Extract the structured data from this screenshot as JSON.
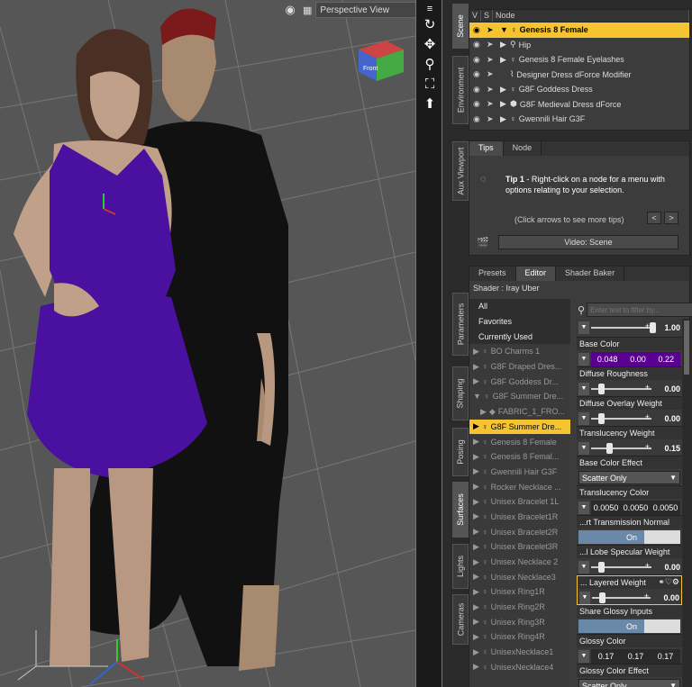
{
  "viewport": {
    "view_label": "Perspective View",
    "cube_label": "Front"
  },
  "side_tabs": [
    "Scene",
    "Environment",
    "Aux Viewport",
    "Parameters",
    "Shaping",
    "Posing",
    "Surfaces",
    "Lights",
    "Cameras"
  ],
  "scene": {
    "col_v": "V",
    "col_s": "S",
    "col_node": "Node",
    "rows": [
      "Genesis 8 Female",
      "Hip",
      "Genesis 8 Female Eyelashes",
      "Designer Dress dForce Modifier",
      "G8F Goddess Dress",
      "G8F Medieval Dress dForce",
      "Gwennili Hair G3F"
    ]
  },
  "tips": {
    "tab1": "Tips",
    "tab2": "Node",
    "tip_prefix": "Tip 1",
    "tip_text": " - Right-click on a node for a menu with options relating to your selection.",
    "hint": "(Click arrows to see more tips)",
    "prev": "<",
    "next": ">",
    "video": "Video: Scene"
  },
  "surfaces": {
    "tabs": [
      "Presets",
      "Editor",
      "Shader Baker"
    ],
    "shader": "Shader : Iray Uber",
    "filter_placeholder": "Enter text to filter by...",
    "list": [
      "All",
      "Favorites",
      "Currently Used",
      "BO Charms 1",
      "G8F Draped Dres...",
      "G8F Goddess Dr...",
      "G8F Summer Dre...",
      "FABRIC_1_FRO...",
      "G8F Summer Dre...",
      "Genesis 8 Female",
      "Genesis 8 Femal...",
      "Gwennili Hair G3F",
      "Rocker Necklace ...",
      "Unisex Bracelet 1L",
      "Unisex Bracelet1R",
      "Unisex Bracelet2R",
      "Unisex Bracelet3R",
      "Unisex Necklace 2",
      "Unisex Necklace3",
      "Unisex Ring1R",
      "Unisex Ring2R",
      "Unisex Ring3R",
      "Unisex Ring4R",
      "UnisexNecklace1",
      "UnisexNecklace4"
    ],
    "props": {
      "top_value": "1.00",
      "base_color": {
        "label": "Base Color",
        "v1": "0.048",
        "v2": "0.00",
        "v3": "0.22",
        "color": "#5a0090"
      },
      "diffuse_roughness": {
        "label": "Diffuse Roughness",
        "value": "0.00",
        "fill": 0.0
      },
      "diffuse_overlay": {
        "label": "Diffuse Overlay Weight",
        "value": "0.00",
        "fill": 0.0
      },
      "translucency_weight": {
        "label": "Translucency Weight",
        "value": "0.15",
        "fill": 0.15
      },
      "base_color_effect": {
        "label": "Base Color Effect",
        "value": "Scatter Only"
      },
      "translucency_color": {
        "label": "Translucency Color",
        "v1": "0.0050",
        "v2": "0.0050",
        "v3": "0.0050"
      },
      "transmission_normal": {
        "label": "...rt Transmission Normal",
        "value": "On"
      },
      "lobe_specular": {
        "label": "...l Lobe Specular Weight",
        "value": "0.00",
        "fill": 0.0
      },
      "layered_weight": {
        "label": "... Layered Weight",
        "value": "0.00",
        "fill": 0.0
      },
      "share_glossy": {
        "label": "Share Glossy Inputs",
        "value": "On"
      },
      "glossy_color": {
        "label": "Glossy Color",
        "v1": "0.17",
        "v2": "0.17",
        "v3": "0.17"
      },
      "glossy_color_effect": {
        "label": "Glossy Color Effect",
        "value": "Scatter Only"
      }
    }
  }
}
